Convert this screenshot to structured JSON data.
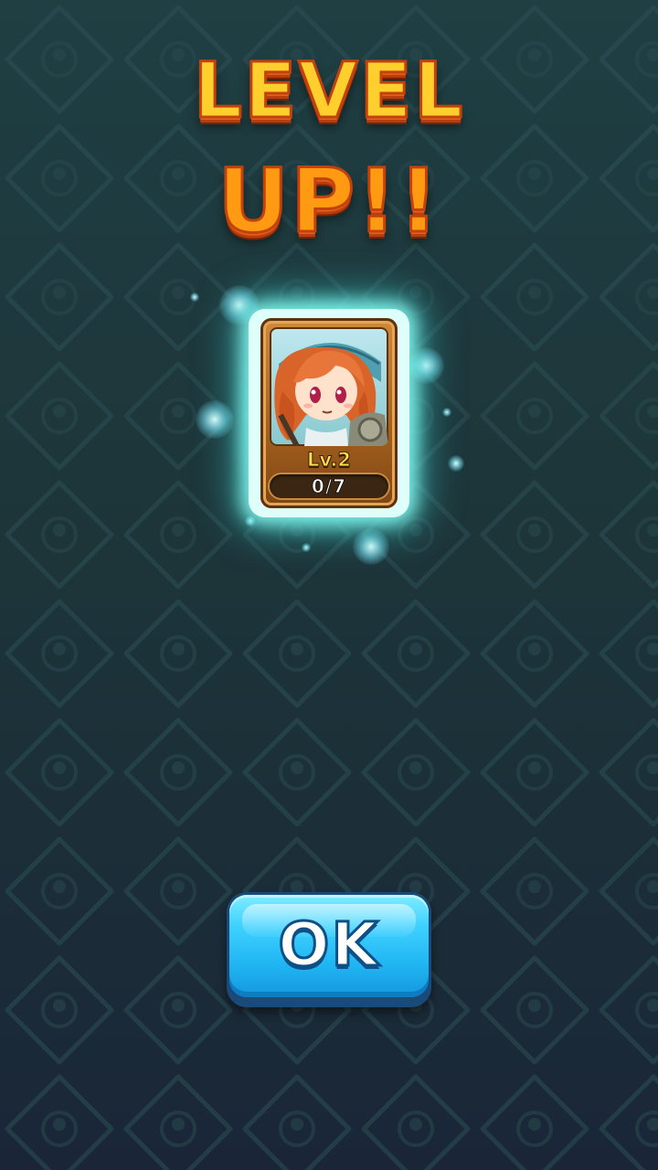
{
  "screen": {
    "title_line1": "LEVEL",
    "title_line2": "UP!!"
  },
  "hero_card": {
    "portrait_icon": "red-haired-warrior-portrait",
    "level_label": "Lv.2",
    "progress_text": "0/7",
    "progress_value": 0,
    "progress_max": 7
  },
  "actions": {
    "ok_label": "OK"
  },
  "colors": {
    "title_gold": "#ffcf2e",
    "title_orange": "#ff9a12",
    "card_frame": "#a7621f",
    "glow_cyan": "#8cfff5",
    "ok_button_blue": "#1fb4f2",
    "background": "#1f3a3f"
  }
}
